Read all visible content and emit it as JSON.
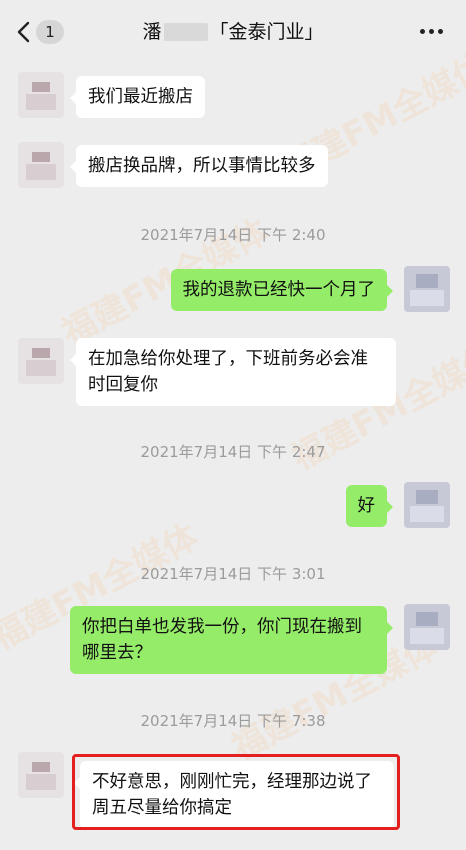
{
  "header": {
    "unread_count": "1",
    "title_prefix": "潘",
    "title_suffix": "「金泰门业」"
  },
  "icons": {
    "back": "chevron-left-icon",
    "more": "more-dots-icon"
  },
  "watermark": "福建FM全媒体",
  "messages": [
    {
      "side": "in",
      "text": "我们最近搬店"
    },
    {
      "side": "in",
      "text": "搬店换品牌，所以事情比较多"
    },
    {
      "timestamp": "2021年7月14日 下午 2:40"
    },
    {
      "side": "out",
      "text": "我的退款已经快一个月了"
    },
    {
      "side": "in",
      "text": "在加急给你处理了，下班前务必会准时回复你"
    },
    {
      "timestamp": "2021年7月14日 下午 2:47"
    },
    {
      "side": "out",
      "text": "好"
    },
    {
      "timestamp": "2021年7月14日 下午 3:01"
    },
    {
      "side": "out",
      "text": "你把白单也发我一份，你门现在搬到哪里去？"
    },
    {
      "timestamp": "2021年7月14日 下午 7:38"
    },
    {
      "side": "in",
      "text": "不好意思，刚刚忙完，经理那边说了周五尽量给你搞定",
      "highlighted": true
    }
  ],
  "colors": {
    "background": "#ededed",
    "incoming_bubble": "#ffffff",
    "outgoing_bubble": "#95ec69",
    "highlight_border": "#e41f1f",
    "timestamp_text": "#9b9b9b"
  }
}
